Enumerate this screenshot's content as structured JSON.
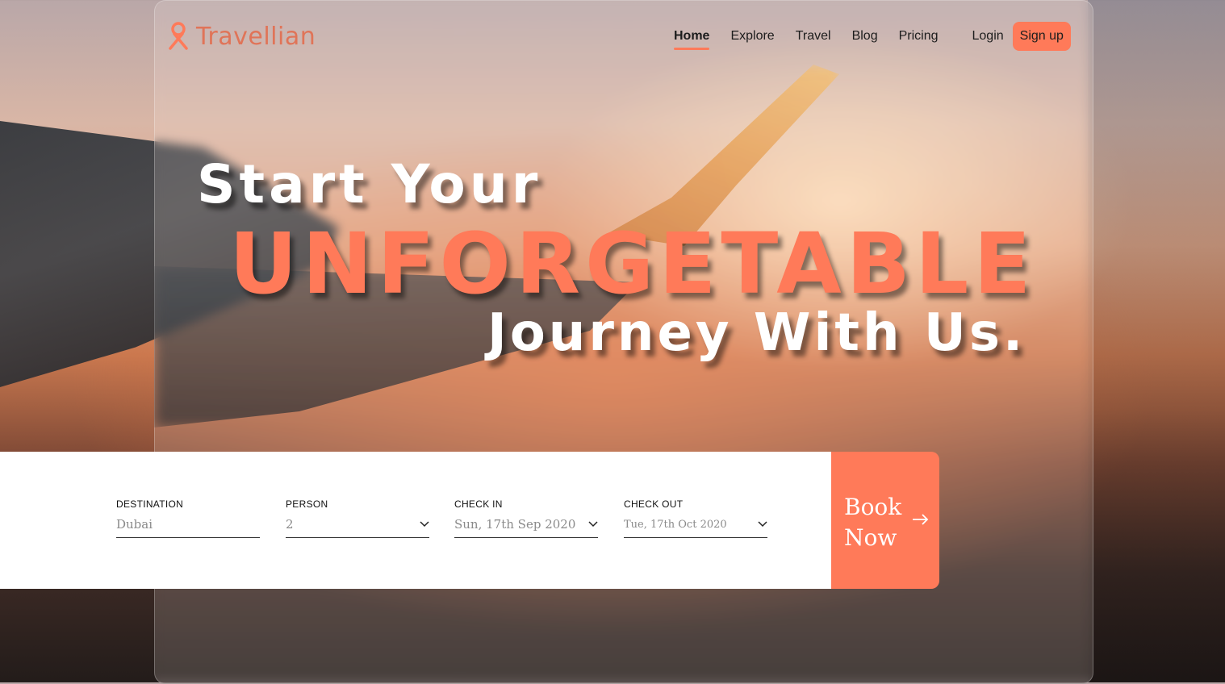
{
  "brand": {
    "name": "Travellian",
    "accent": "#ff7a59"
  },
  "nav": {
    "links": [
      "Home",
      "Explore",
      "Travel",
      "Blog",
      "Pricing"
    ],
    "active": "Home",
    "login": "Login",
    "signup": "Sign up"
  },
  "hero": {
    "line1": "Start Your",
    "line2": "UNFORGETABLE",
    "line3": "Journey With Us."
  },
  "booking": {
    "destination": {
      "label": "DESTINATION",
      "value": "Dubai"
    },
    "person": {
      "label": "PERSON",
      "value": "2"
    },
    "check_in": {
      "label": "CHECK IN",
      "value": "Sun, 17th Sep 2020"
    },
    "check_out": {
      "label": "CHECK OUT",
      "value": "Tue, 17th Oct 2020"
    },
    "button_line1": "Book",
    "button_line2": "Now",
    "icons": {
      "dropdown": "chevron-down-icon",
      "submit": "arrow-right-icon"
    }
  }
}
